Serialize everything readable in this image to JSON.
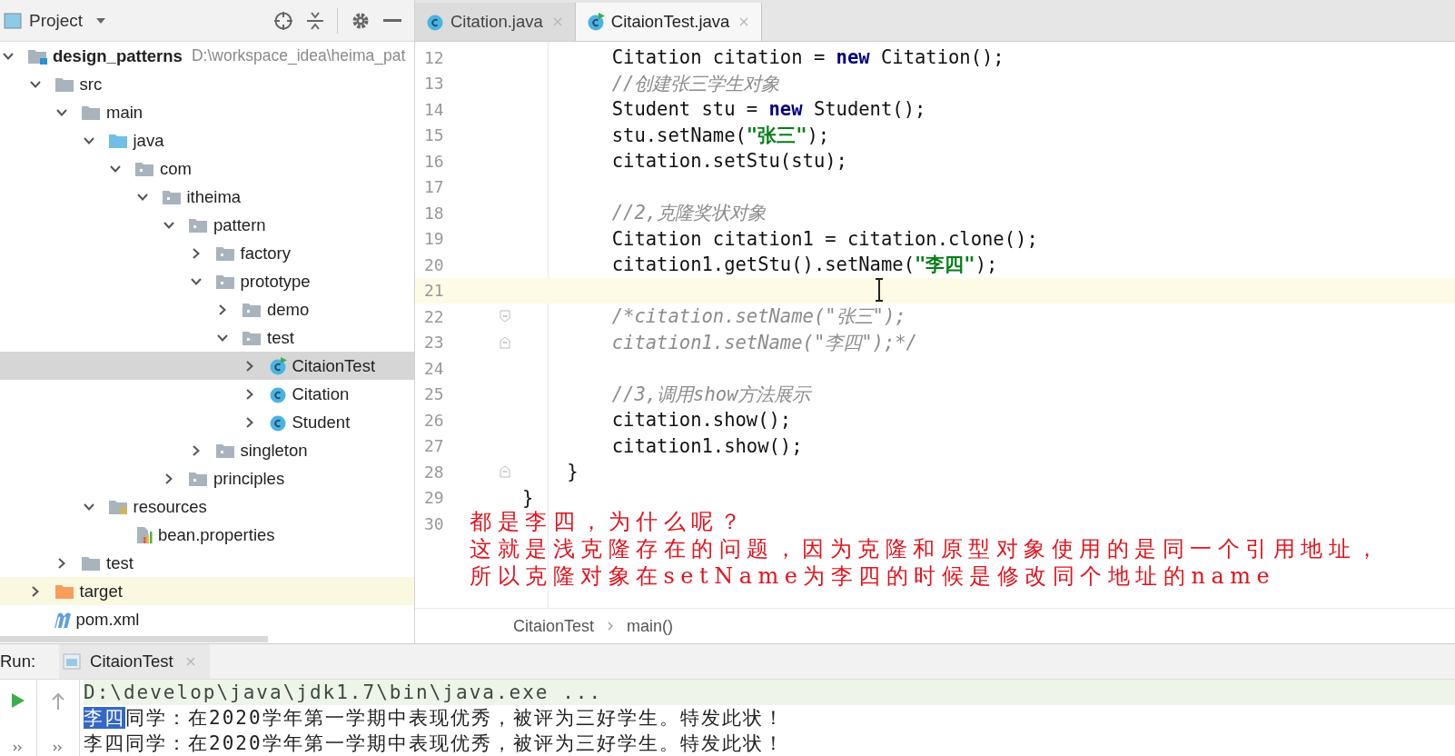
{
  "project_panel": {
    "title": "Project"
  },
  "tree": [
    {
      "label": "design_patterns",
      "path": "D:\\workspace_idea\\heima_pat",
      "kind": "module",
      "expanded": true,
      "selected": false,
      "children": [
        {
          "label": "src",
          "kind": "folder",
          "expanded": true,
          "selected": false,
          "children": [
            {
              "label": "main",
              "kind": "folder",
              "expanded": true,
              "selected": false,
              "children": [
                {
                  "label": "java",
                  "kind": "source",
                  "expanded": true,
                  "selected": false,
                  "children": [
                    {
                      "label": "com",
                      "kind": "package",
                      "expanded": true,
                      "selected": false,
                      "children": [
                        {
                          "label": "itheima",
                          "kind": "package",
                          "expanded": true,
                          "selected": false,
                          "children": [
                            {
                              "label": "pattern",
                              "kind": "package",
                              "expanded": true,
                              "selected": false,
                              "children": [
                                {
                                  "label": "factory",
                                  "kind": "package",
                                  "expanded": false,
                                  "selected": false
                                },
                                {
                                  "label": "prototype",
                                  "kind": "package",
                                  "expanded": true,
                                  "selected": false,
                                  "children": [
                                    {
                                      "label": "demo",
                                      "kind": "package",
                                      "expanded": false,
                                      "selected": false
                                    },
                                    {
                                      "label": "test",
                                      "kind": "package",
                                      "expanded": true,
                                      "selected": false,
                                      "children": [
                                        {
                                          "label": "CitaionTest",
                                          "kind": "test-class",
                                          "expanded": false,
                                          "selected": true
                                        },
                                        {
                                          "label": "Citation",
                                          "kind": "class",
                                          "expanded": false,
                                          "selected": false
                                        },
                                        {
                                          "label": "Student",
                                          "kind": "class",
                                          "expanded": false,
                                          "selected": false
                                        }
                                      ]
                                    }
                                  ]
                                },
                                {
                                  "label": "singleton",
                                  "kind": "package",
                                  "expanded": false,
                                  "selected": false
                                }
                              ]
                            },
                            {
                              "label": "principles",
                              "kind": "package",
                              "expanded": false,
                              "selected": false
                            }
                          ]
                        }
                      ]
                    }
                  ]
                },
                {
                  "label": "resources",
                  "kind": "resources",
                  "expanded": true,
                  "selected": false,
                  "children": [
                    {
                      "label": "bean.properties",
                      "kind": "properties",
                      "selected": false
                    }
                  ]
                }
              ]
            },
            {
              "label": "test",
              "kind": "folder",
              "expanded": false,
              "selected": false
            }
          ]
        },
        {
          "label": "target",
          "kind": "excluded",
          "expanded": false,
          "selected": false
        },
        {
          "label": "pom.xml",
          "kind": "maven",
          "selected": false
        }
      ]
    }
  ],
  "editor_tabs": [
    {
      "label": "Citation.java",
      "kind": "class",
      "selected": false
    },
    {
      "label": "CitaionTest.java",
      "kind": "test-class",
      "selected": true
    }
  ],
  "code_lines": [
    {
      "number": "12",
      "current": false,
      "fold_start": false,
      "fold_end": false,
      "tokens": [
        {
          "kind": "plain",
          "text": "        Citation citation = "
        },
        {
          "kind": "keyword",
          "text": "new"
        },
        {
          "kind": "plain",
          "text": " Citation();"
        }
      ]
    },
    {
      "number": "13",
      "current": false,
      "fold_start": false,
      "fold_end": false,
      "tokens": [
        {
          "kind": "comment",
          "text": "        //创建张三学生对象"
        }
      ]
    },
    {
      "number": "14",
      "current": false,
      "fold_start": false,
      "fold_end": false,
      "tokens": [
        {
          "kind": "plain",
          "text": "        Student stu = "
        },
        {
          "kind": "keyword",
          "text": "new"
        },
        {
          "kind": "plain",
          "text": " Student();"
        }
      ]
    },
    {
      "number": "15",
      "current": false,
      "fold_start": false,
      "fold_end": false,
      "tokens": [
        {
          "kind": "plain",
          "text": "        stu.setName("
        },
        {
          "kind": "string",
          "text": "\"张三\""
        },
        {
          "kind": "plain",
          "text": ");"
        }
      ]
    },
    {
      "number": "16",
      "current": false,
      "fold_start": false,
      "fold_end": false,
      "tokens": [
        {
          "kind": "plain",
          "text": "        citation.setStu(stu);"
        }
      ]
    },
    {
      "number": "17",
      "current": false,
      "fold_start": false,
      "fold_end": false
    },
    {
      "number": "18",
      "current": false,
      "fold_start": false,
      "fold_end": false,
      "tokens": [
        {
          "kind": "comment",
          "text": "        //2,克隆奖状对象"
        }
      ]
    },
    {
      "number": "19",
      "current": false,
      "fold_start": false,
      "fold_end": false,
      "tokens": [
        {
          "kind": "plain",
          "text": "        Citation citation1 = citation.clone();"
        }
      ]
    },
    {
      "number": "20",
      "current": false,
      "fold_start": false,
      "fold_end": false,
      "tokens": [
        {
          "kind": "plain",
          "text": "        citation1.getStu().setName("
        },
        {
          "kind": "string",
          "text": "\"李四\""
        },
        {
          "kind": "plain",
          "text": ");"
        }
      ]
    },
    {
      "number": "21",
      "current": true,
      "fold_start": false,
      "fold_end": false
    },
    {
      "number": "22",
      "current": false,
      "fold_start": true,
      "fold_end": false,
      "tokens": [
        {
          "kind": "comment",
          "text": "        /*citation.setName(\"张三\");"
        }
      ]
    },
    {
      "number": "23",
      "current": false,
      "fold_start": false,
      "fold_end": true,
      "tokens": [
        {
          "kind": "comment",
          "text": "        citation1.setName(\"李四\");*/"
        }
      ]
    },
    {
      "number": "24",
      "current": false,
      "fold_start": false,
      "fold_end": false
    },
    {
      "number": "25",
      "current": false,
      "fold_start": false,
      "fold_end": false,
      "tokens": [
        {
          "kind": "comment",
          "text": "        //3,调用show方法展示"
        }
      ]
    },
    {
      "number": "26",
      "current": false,
      "fold_start": false,
      "fold_end": false,
      "tokens": [
        {
          "kind": "plain",
          "text": "        citation.show();"
        }
      ]
    },
    {
      "number": "27",
      "current": false,
      "fold_start": false,
      "fold_end": false,
      "tokens": [
        {
          "kind": "plain",
          "text": "        citation1.show();"
        }
      ]
    },
    {
      "number": "28",
      "current": false,
      "fold_start": false,
      "fold_end": true,
      "tokens": [
        {
          "kind": "plain",
          "text": "    }"
        }
      ]
    },
    {
      "number": "29",
      "current": false,
      "fold_start": false,
      "fold_end": false,
      "tokens": [
        {
          "kind": "plain",
          "text": "}"
        }
      ]
    },
    {
      "number": "30",
      "current": false,
      "fold_start": false,
      "fold_end": false
    }
  ],
  "annotation": [
    "都是李四，为什么呢？",
    "这就是浅克隆存在的问题，因为克隆和原型对象使用的是同一个引用地址，",
    "所以克隆对象在setName为李四的时候是修改同个地址的name"
  ],
  "breadcrumb": [
    "CitaionTest",
    "main()"
  ],
  "run_panel": {
    "label": "Run:",
    "tab": "CitaionTest",
    "console": [
      [
        {
          "text": "D:\\develop\\java\\jdk1.7\\bin\\java.exe ...",
          "selected": false
        }
      ],
      [
        {
          "text": "李四",
          "selected": true
        },
        {
          "text": "同学：在2020学年第一学期中表现优秀，被评为三好学生。特发此状！",
          "selected": false
        }
      ],
      [
        {
          "text": "李四同学：在2020学年第一学期中表现优秀，被评为三好学生。特发此状！",
          "selected": false
        }
      ]
    ]
  }
}
